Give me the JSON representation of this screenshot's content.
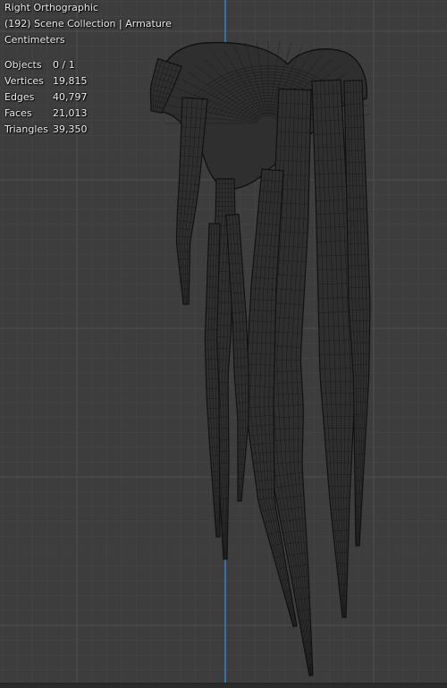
{
  "viewport": {
    "view_name": "Right Orthographic",
    "collection_info": "(192) Scene Collection | Armature",
    "units": "Centimeters"
  },
  "stats": [
    {
      "label": "Objects",
      "value": "0 / 1"
    },
    {
      "label": "Vertices",
      "value": "19,815"
    },
    {
      "label": "Edges",
      "value": "40,797"
    },
    {
      "label": "Faces",
      "value": "21,013"
    },
    {
      "label": "Triangles",
      "value": "39,350"
    }
  ],
  "colors": {
    "background": "#3d3d3d",
    "grid_minor": "#464646",
    "grid_major": "#505050",
    "z_axis": "#3a7fcf",
    "wire": "#111111",
    "wire_fill": "#2f2f2f"
  }
}
